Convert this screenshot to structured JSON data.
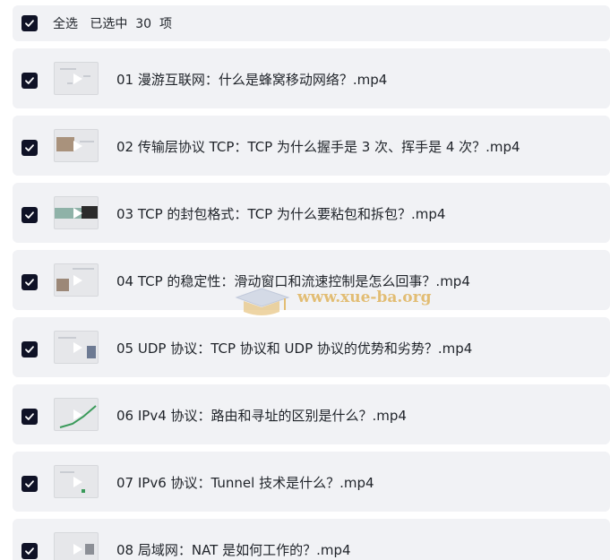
{
  "header": {
    "select_all_label": "全选   已选中  30  项"
  },
  "items": [
    {
      "title": "01  漫游互联网：什么是蜂窝移动网络？.mp4",
      "checked": true,
      "thumb": "thumb-icon"
    },
    {
      "title": "02  传输层协议 TCP：TCP 为什么握手是 3 次、挥手是 4 次？.mp4",
      "checked": true,
      "thumb": "thumb-icon"
    },
    {
      "title": "03  TCP 的封包格式：TCP 为什么要粘包和拆包？.mp4",
      "checked": true,
      "thumb": "thumb-icon"
    },
    {
      "title": "04  TCP 的稳定性：滑动窗口和流速控制是怎么回事？.mp4",
      "checked": true,
      "thumb": "thumb-icon"
    },
    {
      "title": "05  UDP 协议：TCP 协议和 UDP 协议的优势和劣势？.mp4",
      "checked": true,
      "thumb": "thumb-icon"
    },
    {
      "title": "06  IPv4 协议：路由和寻址的区别是什么？.mp4",
      "checked": true,
      "thumb": "thumb-icon"
    },
    {
      "title": "07  IPv6 协议：Tunnel 技术是什么？.mp4",
      "checked": true,
      "thumb": "thumb-icon"
    },
    {
      "title": "08  局域网：NAT 是如何工作的？.mp4",
      "checked": true,
      "thumb": "thumb-icon"
    }
  ],
  "watermark": {
    "text": "www.xue-ba.org"
  },
  "colors": {
    "checkbox": "#0f1226",
    "row_bg": "#f1f2f5",
    "watermark": "#e0b45e"
  }
}
